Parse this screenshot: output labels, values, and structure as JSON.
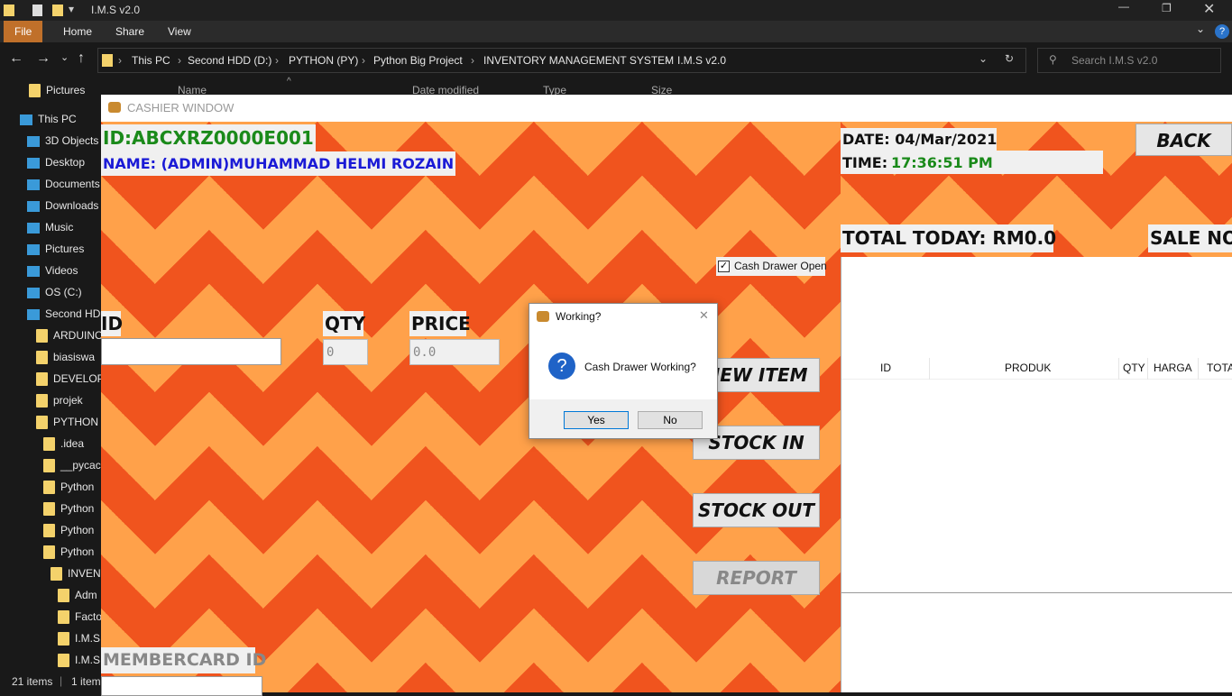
{
  "explorer": {
    "title": "I.M.S v2.0",
    "ribbon_tabs": [
      "File",
      "Home",
      "Share",
      "View"
    ],
    "breadcrumb": [
      "This PC",
      "Second HDD (D:)",
      "PYTHON (PY)",
      "Python Big Project",
      "INVENTORY MANAGEMENT SYSTEM",
      "I.M.S v2.0"
    ],
    "search_placeholder": "Search I.M.S v2.0",
    "columns": [
      "Name",
      "Date modified",
      "Type",
      "Size"
    ],
    "nav": [
      {
        "label": "Pictures",
        "icon": "folder-icon"
      },
      {
        "label": "This PC",
        "icon": "pc-icon"
      },
      {
        "label": "3D Objects",
        "icon": "3d-icon"
      },
      {
        "label": "Desktop",
        "icon": "desktop-icon"
      },
      {
        "label": "Documents",
        "icon": "document-icon"
      },
      {
        "label": "Downloads",
        "icon": "download-icon"
      },
      {
        "label": "Music",
        "icon": "music-icon"
      },
      {
        "label": "Pictures",
        "icon": "picture-icon"
      },
      {
        "label": "Videos",
        "icon": "video-icon"
      },
      {
        "label": "OS (C:)",
        "icon": "drive-icon"
      },
      {
        "label": "Second HDD",
        "icon": "drive-icon"
      },
      {
        "label": "ARDUINO",
        "icon": "folder-icon"
      },
      {
        "label": "biasiswa",
        "icon": "folder-icon"
      },
      {
        "label": "DEVELOP",
        "icon": "folder-icon"
      },
      {
        "label": "projek",
        "icon": "folder-icon"
      },
      {
        "label": "PYTHON",
        "icon": "folder-icon"
      },
      {
        "label": ".idea",
        "icon": "folder-icon"
      },
      {
        "label": "__pycac",
        "icon": "folder-icon"
      },
      {
        "label": "Python",
        "icon": "folder-icon"
      },
      {
        "label": "Python",
        "icon": "folder-icon"
      },
      {
        "label": "Python",
        "icon": "folder-icon"
      },
      {
        "label": "Python",
        "icon": "folder-icon"
      },
      {
        "label": "INVEN",
        "icon": "folder-icon"
      },
      {
        "label": "Adm",
        "icon": "folder-icon"
      },
      {
        "label": "Facto",
        "icon": "folder-icon"
      },
      {
        "label": "I.M.S",
        "icon": "folder-icon"
      },
      {
        "label": "I.M.S",
        "icon": "folder-icon"
      }
    ],
    "status_items": "21 items",
    "status_selected": "1 item"
  },
  "cashier": {
    "window_title": "CASHIER WINDOW",
    "user_id": "ID:ABCXRZ0000E001",
    "user_name": "NAME: (ADMIN)MUHAMMAD HELMI ROZAIN",
    "date_label": "DATE: 04/Mar/2021",
    "time_label": "TIME:",
    "time_value": "17:36:51 PM",
    "back_label": "BACK",
    "total_today": "TOTAL TODAY: RM0.0",
    "sale_no": "SALE NO",
    "cash_drawer_label": "Cash Drawer Open",
    "cash_drawer_checked": true,
    "id_label": "ID",
    "qty_label": "QTY",
    "qty_value": "0",
    "price_label": "PRICE",
    "price_value": "0.0",
    "btn_new_item": "NEW ITEM",
    "btn_stock_in": "STOCK IN",
    "btn_stock_out": "STOCK OUT",
    "btn_report": "REPORT",
    "membercard_label": "MEMBERCARD ID",
    "table_headers": [
      "ID",
      "PRODUK",
      "QTY",
      "HARGA",
      "TOTA"
    ]
  },
  "dialog": {
    "title": "Working?",
    "message": "Cash Drawer Working?",
    "yes": "Yes",
    "no": "No"
  },
  "colors": {
    "pattern_dark": "#f0541e",
    "pattern_light": "#ffa14a",
    "id_green": "#1a8a1a",
    "name_blue": "#1a1ad6"
  }
}
